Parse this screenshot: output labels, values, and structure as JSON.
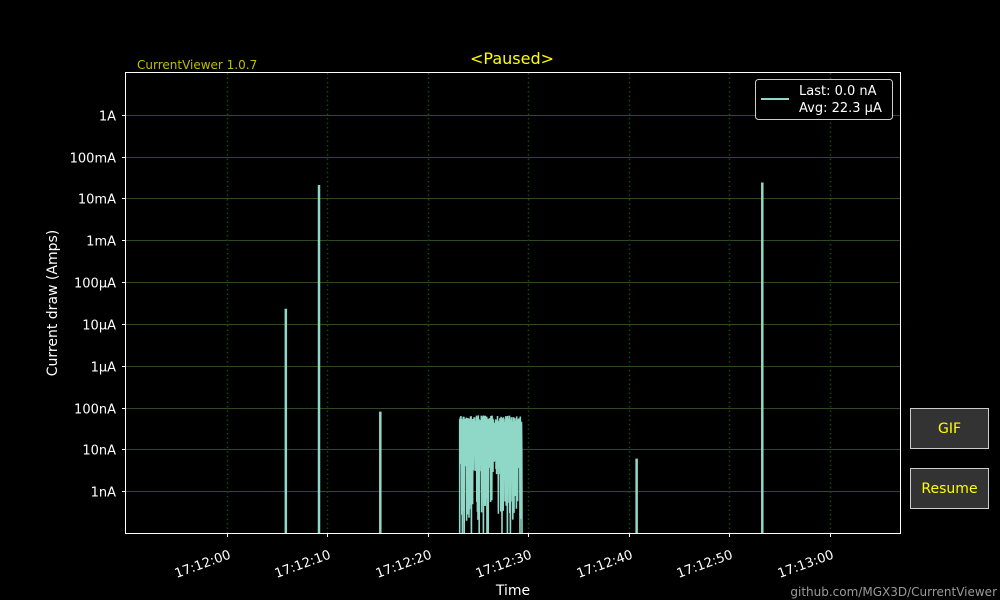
{
  "app": {
    "version_label": "CurrentViewer 1.0.7",
    "footer": "github.com/MGX3D/CurrentViewer"
  },
  "buttons": {
    "gif": "GIF",
    "resume": "Resume"
  },
  "colors": {
    "background": "#000000",
    "axes_frame": "#ffffff",
    "title": "#ffff00",
    "version": "#bfbf00",
    "series": "#8fd7c6",
    "y_grid": "#2f4a22",
    "x_grid": "#0f4a0f",
    "button_bg": "#333333",
    "button_text": "#ffff00"
  },
  "chart_data": {
    "type": "line",
    "title": "<Paused>",
    "xlabel": "Time",
    "ylabel": "Current draw (Amps)",
    "yscale": "log",
    "ylim": [
      1e-10,
      10
    ],
    "xlim": [
      "17:11:50",
      "17:13:07"
    ],
    "x_ticks": [
      "17:12:00",
      "17:12:10",
      "17:12:20",
      "17:12:30",
      "17:12:40",
      "17:12:50",
      "17:13:00"
    ],
    "y_ticks": [
      {
        "value": 1e-09,
        "label": "1nA"
      },
      {
        "value": 1e-08,
        "label": "10nA"
      },
      {
        "value": 1e-07,
        "label": "100nA"
      },
      {
        "value": 1e-06,
        "label": "1µA"
      },
      {
        "value": 1e-05,
        "label": "10µA"
      },
      {
        "value": 0.0001,
        "label": "100µA"
      },
      {
        "value": 0.001,
        "label": "1mA"
      },
      {
        "value": 0.01,
        "label": "10mA"
      },
      {
        "value": 0.1,
        "label": "100mA"
      },
      {
        "value": 1,
        "label": "1A"
      }
    ],
    "grid": {
      "y": "major lines",
      "x": "dotted"
    },
    "legend": {
      "placement": "top-right",
      "entries": [
        "Last: 0.0 nA",
        "Avg: 22.3 µA"
      ]
    },
    "series": [
      {
        "spikes": [
          {
            "time": "17:12:05.9",
            "value": 2.3e-05
          },
          {
            "time": "17:12:09.2",
            "value": 0.021
          },
          {
            "time": "17:12:15.3",
            "value": 8e-08
          },
          {
            "time": "17:12:40.8",
            "value": 6e-09
          },
          {
            "time": "17:12:53.3",
            "value": 0.024
          }
        ],
        "burst": {
          "start": "17:12:23.2",
          "end": "17:12:29.4",
          "peak": 6.5e-08
        }
      }
    ]
  }
}
